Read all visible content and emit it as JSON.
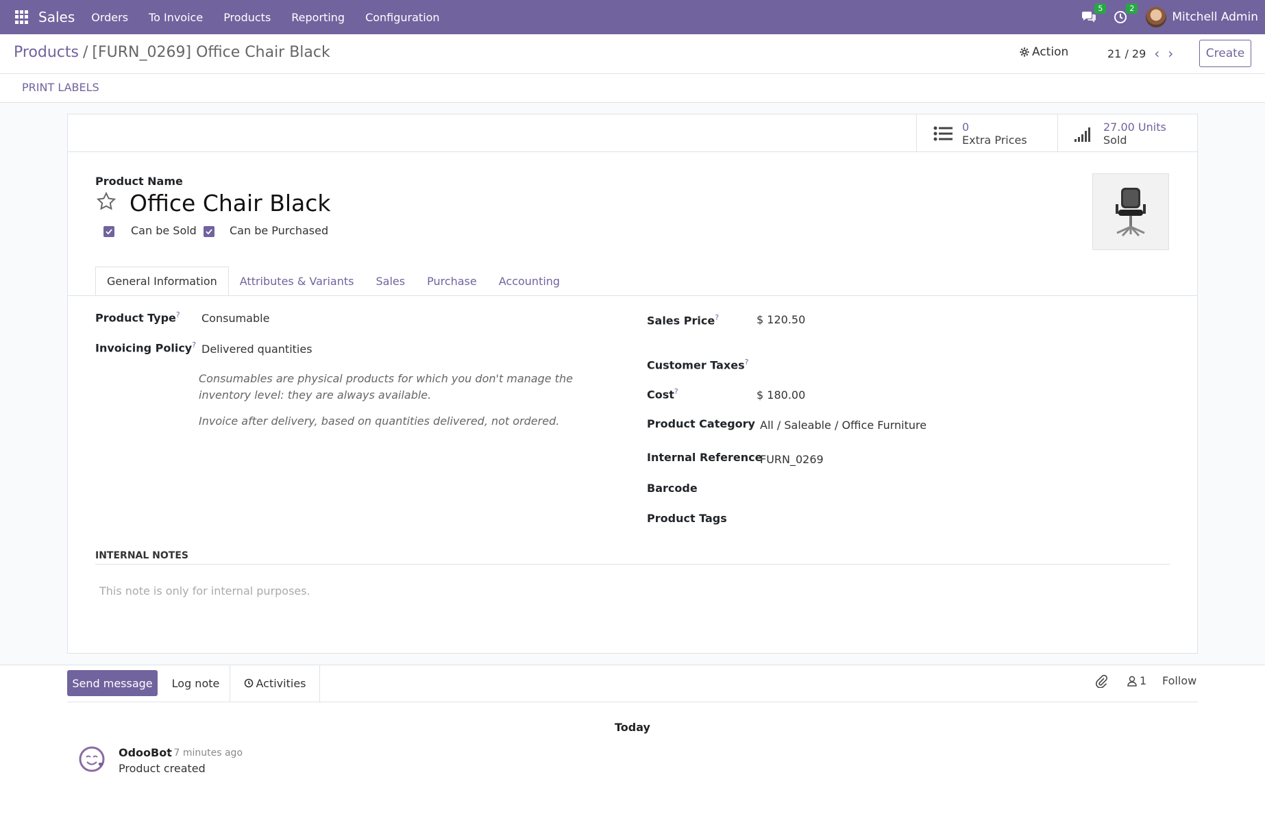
{
  "navbar": {
    "brand": "Sales",
    "menu": [
      "Orders",
      "To Invoice",
      "Products",
      "Reporting",
      "Configuration"
    ],
    "messages_count": "5",
    "activities_count": "2",
    "user_name": "Mitchell Admin"
  },
  "control_panel": {
    "breadcrumb_parent": "Products",
    "breadcrumb_separator": "/",
    "breadcrumb_current": "[FURN_0269] Office Chair Black",
    "action_label": "Action",
    "pager": "21 / 29",
    "create_label": "Create"
  },
  "statusbar": {
    "print_labels": "PRINT LABELS"
  },
  "smart_buttons": {
    "extra_prices_value": "0",
    "extra_prices_label": "Extra Prices",
    "sold_value": "27.00 Units",
    "sold_label": "Sold"
  },
  "product": {
    "name_label": "Product Name",
    "name": "Office Chair Black",
    "can_be_sold_label": "Can be Sold",
    "can_be_purchased_label": "Can be Purchased"
  },
  "tabs": [
    "General Information",
    "Attributes & Variants",
    "Sales",
    "Purchase",
    "Accounting"
  ],
  "general": {
    "product_type_label": "Product Type",
    "product_type": "Consumable",
    "invoicing_policy_label": "Invoicing Policy",
    "invoicing_policy": "Delivered quantities",
    "help_consumable": "Consumables are physical products for which you don't manage the inventory level: they are always available.",
    "help_invoice": "Invoice after delivery, based on quantities delivered, not ordered.",
    "sales_price_label": "Sales Price",
    "currency": "$",
    "sales_price": "120.50",
    "customer_taxes_label": "Customer Taxes",
    "cost_label": "Cost",
    "cost": "180.00",
    "product_category_label": "Product Category",
    "product_category": "All / Saleable / Office Furniture",
    "internal_reference_label": "Internal Reference",
    "internal_reference": "FURN_0269",
    "barcode_label": "Barcode",
    "product_tags_label": "Product Tags",
    "question_mark": "?"
  },
  "notes": {
    "title": "INTERNAL NOTES",
    "placeholder": "This note is only for internal purposes."
  },
  "chatter": {
    "send_message": "Send message",
    "log_note": "Log note",
    "activities": "Activities",
    "followers_count": "1",
    "follow": "Follow",
    "today": "Today",
    "message_author": "OdooBot",
    "message_time": "- 7 minutes ago",
    "message_body": "Product created"
  },
  "colors": {
    "brand": "#71639e",
    "badge": "#28a745"
  }
}
